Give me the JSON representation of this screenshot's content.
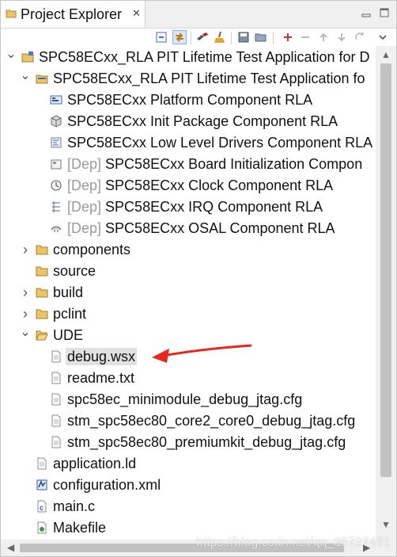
{
  "view": {
    "title": "Project Explorer",
    "close_glyph": "✕"
  },
  "toolbar": {
    "buttons": [
      {
        "name": "collapse-all-icon"
      },
      {
        "name": "link-with-editor-icon",
        "selected": true
      },
      {
        "name": "build-icon"
      },
      {
        "name": "clean-icon"
      },
      {
        "name": "save-icon"
      },
      {
        "name": "open-folder-icon"
      },
      {
        "name": "add-icon"
      },
      {
        "name": "remove-icon"
      },
      {
        "name": "move-up-icon"
      },
      {
        "name": "move-down-icon"
      },
      {
        "name": "sync-icon"
      },
      {
        "name": "view-menu-icon"
      }
    ]
  },
  "tree": {
    "rows": [
      {
        "depth": 0,
        "twisty": "open",
        "icon": "project-icon",
        "label": "SPC58ECxx_RLA PIT Lifetime Test Application for D"
      },
      {
        "depth": 1,
        "twisty": "open",
        "icon": "application-icon",
        "label": "SPC58ECxx_RLA PIT Lifetime Test Application fo"
      },
      {
        "depth": 2,
        "twisty": "none",
        "icon": "platform-component-icon",
        "label": "SPC58ECxx Platform Component RLA"
      },
      {
        "depth": 2,
        "twisty": "none",
        "icon": "init-package-icon",
        "label": "SPC58ECxx Init Package Component RLA"
      },
      {
        "depth": 2,
        "twisty": "none",
        "icon": "low-level-drivers-icon",
        "label": "SPC58ECxx Low Level Drivers Component RLA"
      },
      {
        "depth": 2,
        "twisty": "none",
        "icon": "board-init-icon",
        "dep": "[Dep]",
        "label": "SPC58ECxx Board Initialization Compon"
      },
      {
        "depth": 2,
        "twisty": "none",
        "icon": "clock-icon",
        "dep": "[Dep]",
        "label": "SPC58ECxx Clock Component RLA"
      },
      {
        "depth": 2,
        "twisty": "none",
        "icon": "irq-icon",
        "dep": "[Dep]",
        "label": "SPC58ECxx IRQ Component RLA"
      },
      {
        "depth": 2,
        "twisty": "none",
        "icon": "osal-icon",
        "dep": "[Dep]",
        "label": "SPC58ECxx OSAL Component RLA"
      },
      {
        "depth": 1,
        "twisty": "closed",
        "icon": "folder-icon",
        "label": "components"
      },
      {
        "depth": 1,
        "twisty": "none",
        "icon": "folder-icon",
        "label": "source"
      },
      {
        "depth": 1,
        "twisty": "closed",
        "icon": "folder-icon",
        "label": "build"
      },
      {
        "depth": 1,
        "twisty": "closed",
        "icon": "folder-icon",
        "label": "pclint"
      },
      {
        "depth": 1,
        "twisty": "open",
        "icon": "folder-open-icon",
        "label": "UDE"
      },
      {
        "depth": 2,
        "twisty": "none",
        "icon": "file-icon",
        "label": "debug.wsx",
        "selected": true
      },
      {
        "depth": 2,
        "twisty": "none",
        "icon": "file-icon",
        "label": "readme.txt"
      },
      {
        "depth": 2,
        "twisty": "none",
        "icon": "file-icon",
        "label": "spc58ec_minimodule_debug_jtag.cfg"
      },
      {
        "depth": 2,
        "twisty": "none",
        "icon": "file-icon",
        "label": "stm_spc58ec80_core2_core0_debug_jtag.cfg"
      },
      {
        "depth": 2,
        "twisty": "none",
        "icon": "file-icon",
        "label": "stm_spc58ec80_premiumkit_debug_jtag.cfg"
      },
      {
        "depth": 1,
        "twisty": "none",
        "icon": "file-icon",
        "label": "application.ld"
      },
      {
        "depth": 1,
        "twisty": "none",
        "icon": "configuration-icon",
        "label": "configuration.xml"
      },
      {
        "depth": 1,
        "twisty": "none",
        "icon": "c-file-icon",
        "label": "main.c"
      },
      {
        "depth": 1,
        "twisty": "none",
        "icon": "makefile-icon",
        "label": "Makefile"
      }
    ]
  },
  "watermark": "https://blog.csdn.net/qq_35727491",
  "colors": {
    "folder": "#e9c46a",
    "arrow": "#e8261c",
    "selection": "#e1e1e1",
    "dep_text": "#9a9a9a"
  }
}
